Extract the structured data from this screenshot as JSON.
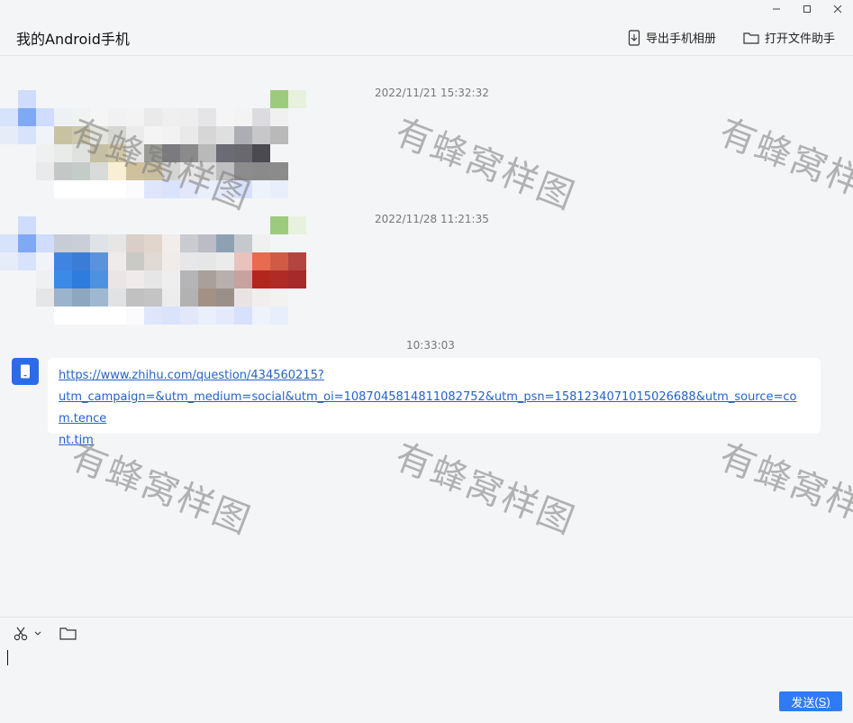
{
  "window": {
    "title": "我的Android手机",
    "controls": [
      "minimize",
      "maximize",
      "close"
    ]
  },
  "header": {
    "export_label": "导出手机相册",
    "open_helper_label": "打开文件助手"
  },
  "messages": [
    {
      "timestamp": "2022/11/21 15:32:32",
      "type": "image",
      "blurred": true
    },
    {
      "timestamp": "2022/11/28 11:21:35",
      "type": "image",
      "blurred": true
    },
    {
      "timestamp": "10:33:03",
      "type": "link",
      "link_line1": "https://www.zhihu.com/question/434560215?",
      "link_line2": "utm_campaign=&utm_medium=social&utm_oi=1087045814811082752&utm_psn=1581234071015026688&utm_source=com.tence",
      "link_line3": "nt.tim"
    }
  ],
  "watermark": "有蜂窝样图",
  "composer": {
    "tools": [
      "scissors-icon",
      "folder-icon"
    ],
    "input_value": "",
    "send_label": "发送",
    "send_shortcut": "(S)"
  },
  "colors": {
    "accent": "#2f7bf5",
    "avatar": "#2c6be8",
    "link": "#2563c9",
    "background": "#f4f5f7"
  }
}
